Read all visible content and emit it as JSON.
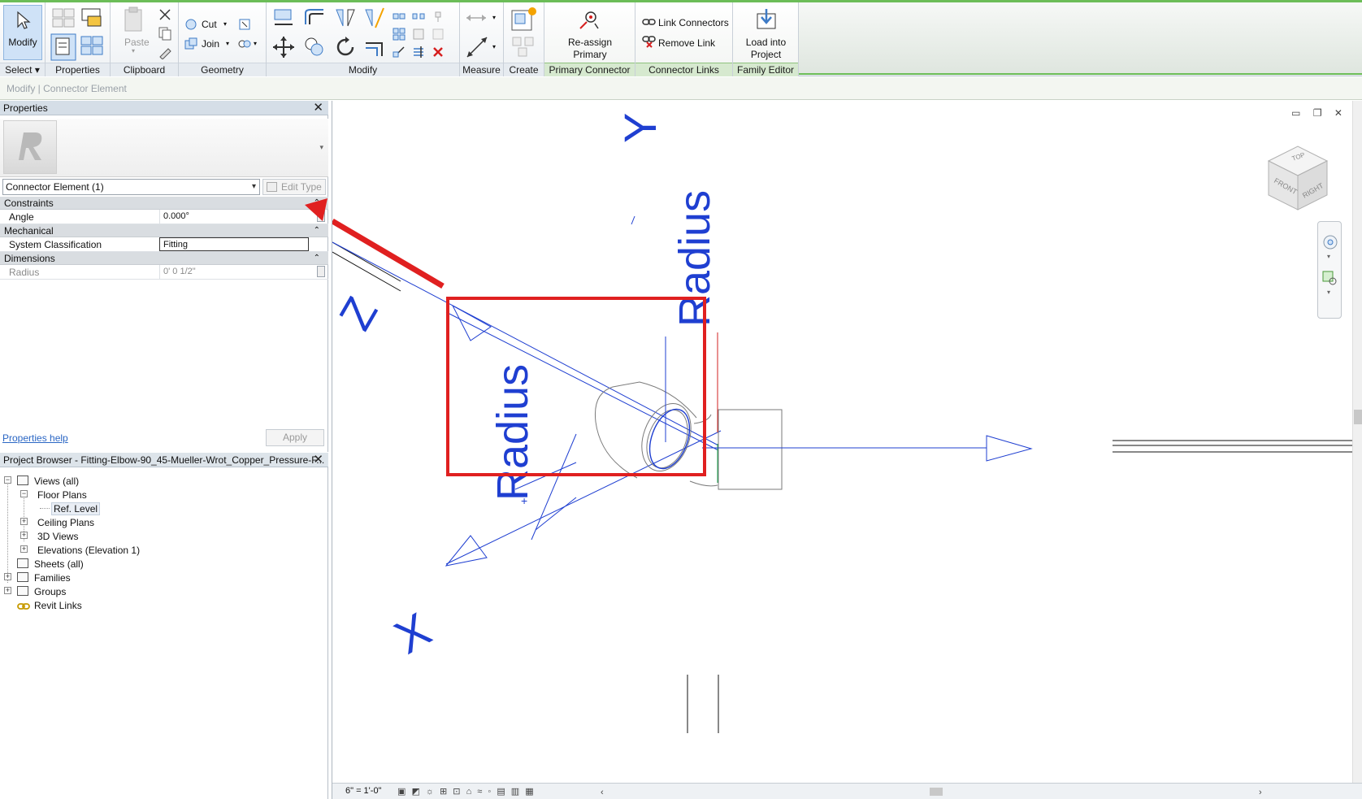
{
  "ribbon": {
    "select": {
      "modify_label": "Modify",
      "panel_label": "Select ▾"
    },
    "properties": {
      "panel_label": "Properties"
    },
    "clipboard": {
      "paste_label": "Paste",
      "panel_label": "Clipboard"
    },
    "geometry": {
      "cut_label": "Cut",
      "join_label": "Join",
      "panel_label": "Geometry"
    },
    "modify": {
      "panel_label": "Modify"
    },
    "measure": {
      "panel_label": "Measure"
    },
    "create": {
      "panel_label": "Create"
    },
    "primary_connector": {
      "button_label_1": "Re-assign",
      "button_label_2": "Primary",
      "panel_label": "Primary Connector"
    },
    "connector_links": {
      "link_label": "Link Connectors",
      "remove_label": "Remove Link",
      "panel_label": "Connector Links"
    },
    "family_editor": {
      "load_label_1": "Load into",
      "load_label_2": "Project",
      "panel_label": "Family Editor"
    },
    "accent_color": "#6cbd58"
  },
  "options_bar": {
    "text": "Modify | Connector Element"
  },
  "properties_panel": {
    "title": "Properties",
    "type_selector": "Connector Element (1)",
    "edit_type_label": "Edit Type",
    "groups": [
      {
        "name": "Constraints",
        "rows": [
          {
            "key": "Angle",
            "value": "0.000°"
          }
        ]
      },
      {
        "name": "Mechanical",
        "rows": [
          {
            "key": "System Classification",
            "value": "Fitting"
          }
        ]
      },
      {
        "name": "Dimensions",
        "rows": [
          {
            "key": "Radius",
            "value": "0'  0 1/2\""
          }
        ]
      }
    ],
    "help_link": "Properties help",
    "apply_label": "Apply"
  },
  "project_browser": {
    "title": "Project Browser - Fitting-Elbow-90_45-Mueller-Wrot_Copper_Pressure-F...",
    "nodes": [
      {
        "label": "Views (all)"
      },
      {
        "label": "Floor Plans"
      },
      {
        "label": "Ref. Level"
      },
      {
        "label": "Ceiling Plans"
      },
      {
        "label": "3D Views"
      },
      {
        "label": "Elevations (Elevation 1)"
      },
      {
        "label": "Sheets (all)"
      },
      {
        "label": "Families"
      },
      {
        "label": "Groups"
      },
      {
        "label": "Revit Links"
      }
    ]
  },
  "canvas": {
    "labels": {
      "y_axis": "Y",
      "z_axis": "Z",
      "x_axis": "X",
      "radius_right": "Radius",
      "radius_left": "Radius"
    },
    "viewcube": {
      "top": "TOP",
      "front": "FRONT",
      "right": "RIGHT"
    },
    "scale": "6\" = 1'-0\"",
    "annotation_color": "#e02020",
    "axis_color": "#1f3fd1"
  }
}
